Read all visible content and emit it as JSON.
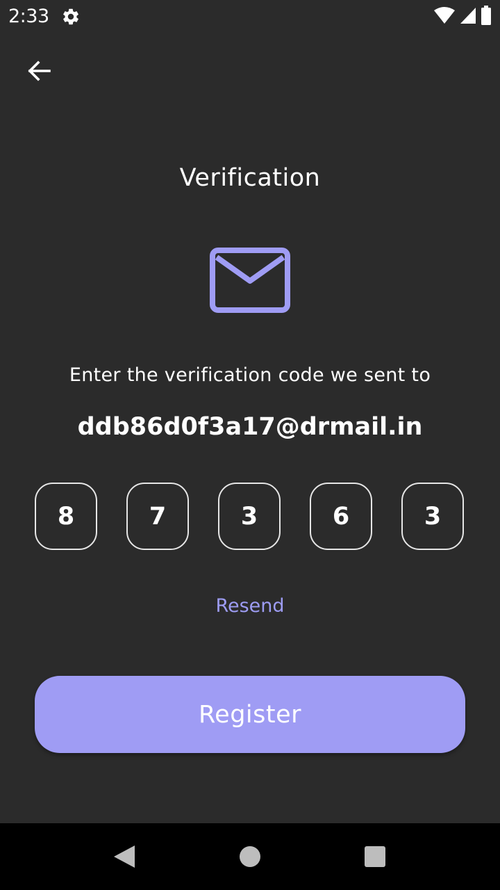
{
  "status_bar": {
    "time": "2:33",
    "icons": [
      "gear-icon",
      "wifi-icon",
      "signal-icon",
      "battery-icon"
    ]
  },
  "header": {
    "back_icon": "arrow-left-icon"
  },
  "main": {
    "title": "Verification",
    "icon": "mail-icon",
    "instruction": "Enter the verification code we sent to",
    "email": "ddb86d0f3a17@drmail.in",
    "code_digits": [
      "8",
      "7",
      "3",
      "6",
      "3"
    ],
    "resend_label": "Resend",
    "register_label": "Register"
  },
  "nav_bar": {
    "icons": [
      "nav-back-icon",
      "nav-home-icon",
      "nav-recents-icon"
    ]
  },
  "colors": {
    "background": "#2b2b2b",
    "accent": "#9f9cf4",
    "accent_text": "#9d9cf3",
    "nav_background": "#000000"
  }
}
